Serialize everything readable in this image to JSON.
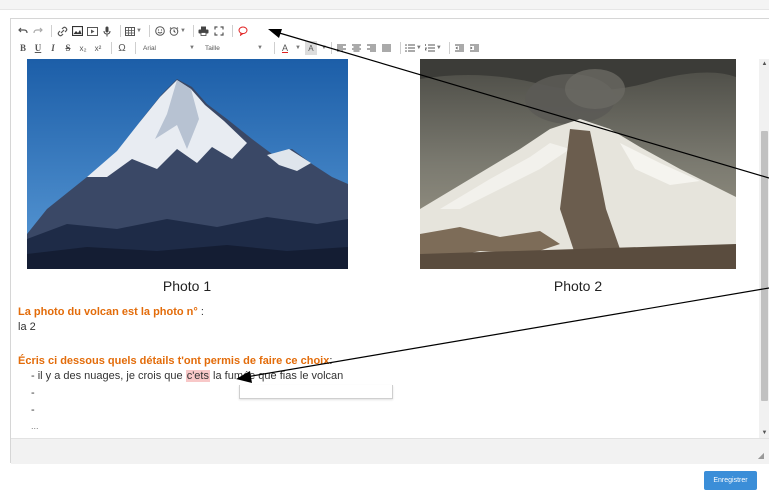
{
  "toolbar": {
    "font_select": "Arial",
    "size_select": "Taille",
    "bold": "B",
    "underline": "U",
    "italic": "I",
    "strike": "S",
    "subscript": "x₂",
    "superscript": "x²",
    "special_char": "Ω",
    "text_color": "A",
    "bg_color": "A"
  },
  "content": {
    "caption_1": "Photo 1",
    "caption_2": "Photo 2",
    "question_1": "La photo du volcan est la photo n°",
    "question_1_colon": " :",
    "answer_1": "la 2",
    "question_2": "Écris ci dessous quels détails t'ont permis de faire ce choix",
    "question_2_colon": ":",
    "list": {
      "item_1_before": "-  il y a des nuages, je crois que ",
      "item_1_misspelled": "c'ets",
      "item_1_after": " la fumée que fias le volcan",
      "item_2": "-",
      "item_3": "-",
      "item_4": "..."
    }
  },
  "footer": {
    "save_button": "Enregistrer"
  },
  "colors": {
    "question_orange": "#e36c0a",
    "save_blue": "#3b8ed8",
    "misspelled_highlight": "#f8c8c8",
    "cursor_marker_red": "#e02020"
  }
}
